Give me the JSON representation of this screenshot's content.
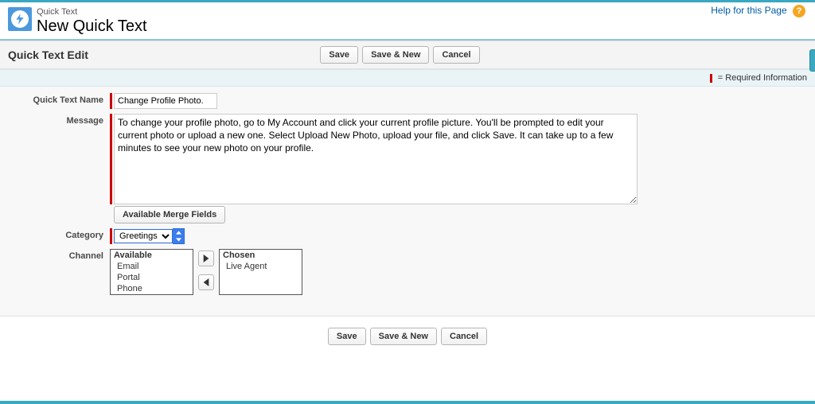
{
  "header": {
    "breadcrumb": "Quick Text",
    "title": "New Quick Text",
    "help_label": "Help for this Page"
  },
  "section": {
    "heading": "Quick Text Edit"
  },
  "buttons": {
    "save": "Save",
    "save_new": "Save & New",
    "cancel": "Cancel"
  },
  "required_legend": "= Required Information",
  "fields": {
    "name_label": "Quick Text Name",
    "name_value": "Change Profile Photo.",
    "message_label": "Message",
    "message_value": "To change your profile photo, go to My Account and click your current profile picture. You'll be prompted to edit your current photo or upload a new one. Select Upload New Photo, upload your file, and click Save. It can take up to a few minutes to see your new photo on your profile.",
    "merge_fields_label": "Available Merge Fields",
    "category_label": "Category",
    "category_value": "Greetings",
    "channel_label": "Channel",
    "available_heading": "Available",
    "available_items": [
      "Email",
      "Portal",
      "Phone"
    ],
    "chosen_heading": "Chosen",
    "chosen_items": [
      "Live Agent"
    ]
  }
}
